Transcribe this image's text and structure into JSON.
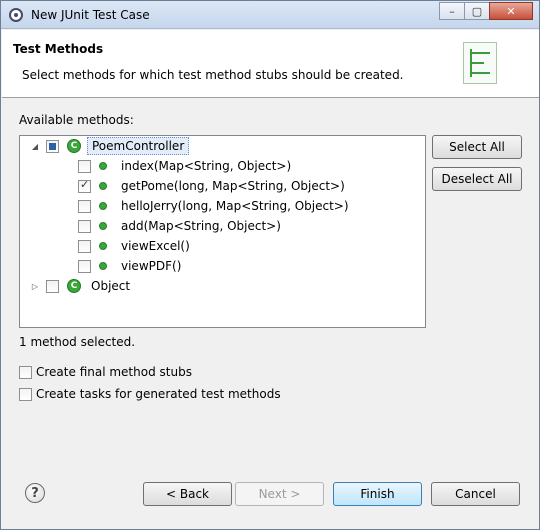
{
  "window": {
    "title": "New JUnit Test Case"
  },
  "header": {
    "title": "Test Methods",
    "description": "Select methods for which test method stubs should be created."
  },
  "available_label": "Available methods:",
  "tree": [
    {
      "label": "PoemController",
      "type": "class",
      "checked": "partial",
      "expanded": true
    },
    {
      "label": "index(Map<String, Object>)",
      "type": "method",
      "checked": false
    },
    {
      "label": "getPome(long, Map<String, Object>)",
      "type": "method",
      "checked": true
    },
    {
      "label": "helloJerry(long, Map<String, Object>)",
      "type": "method",
      "checked": false
    },
    {
      "label": "add(Map<String, Object>)",
      "type": "method",
      "checked": false
    },
    {
      "label": "viewExcel()",
      "type": "method",
      "checked": false
    },
    {
      "label": "viewPDF()",
      "type": "method",
      "checked": false
    },
    {
      "label": "Object",
      "type": "class",
      "checked": false,
      "expanded": false
    }
  ],
  "buttons": {
    "select_all": "Select All",
    "deselect_all": "Deselect All",
    "back": "< Back",
    "next": "Next >",
    "finish": "Finish",
    "cancel": "Cancel"
  },
  "status": "1 method selected.",
  "options": {
    "final_stubs": "Create final method stubs",
    "tasks": "Create tasks for generated test methods"
  },
  "help_symbol": "?",
  "icons": {
    "class_letter": "C",
    "accent_green": "#3aa63a"
  }
}
